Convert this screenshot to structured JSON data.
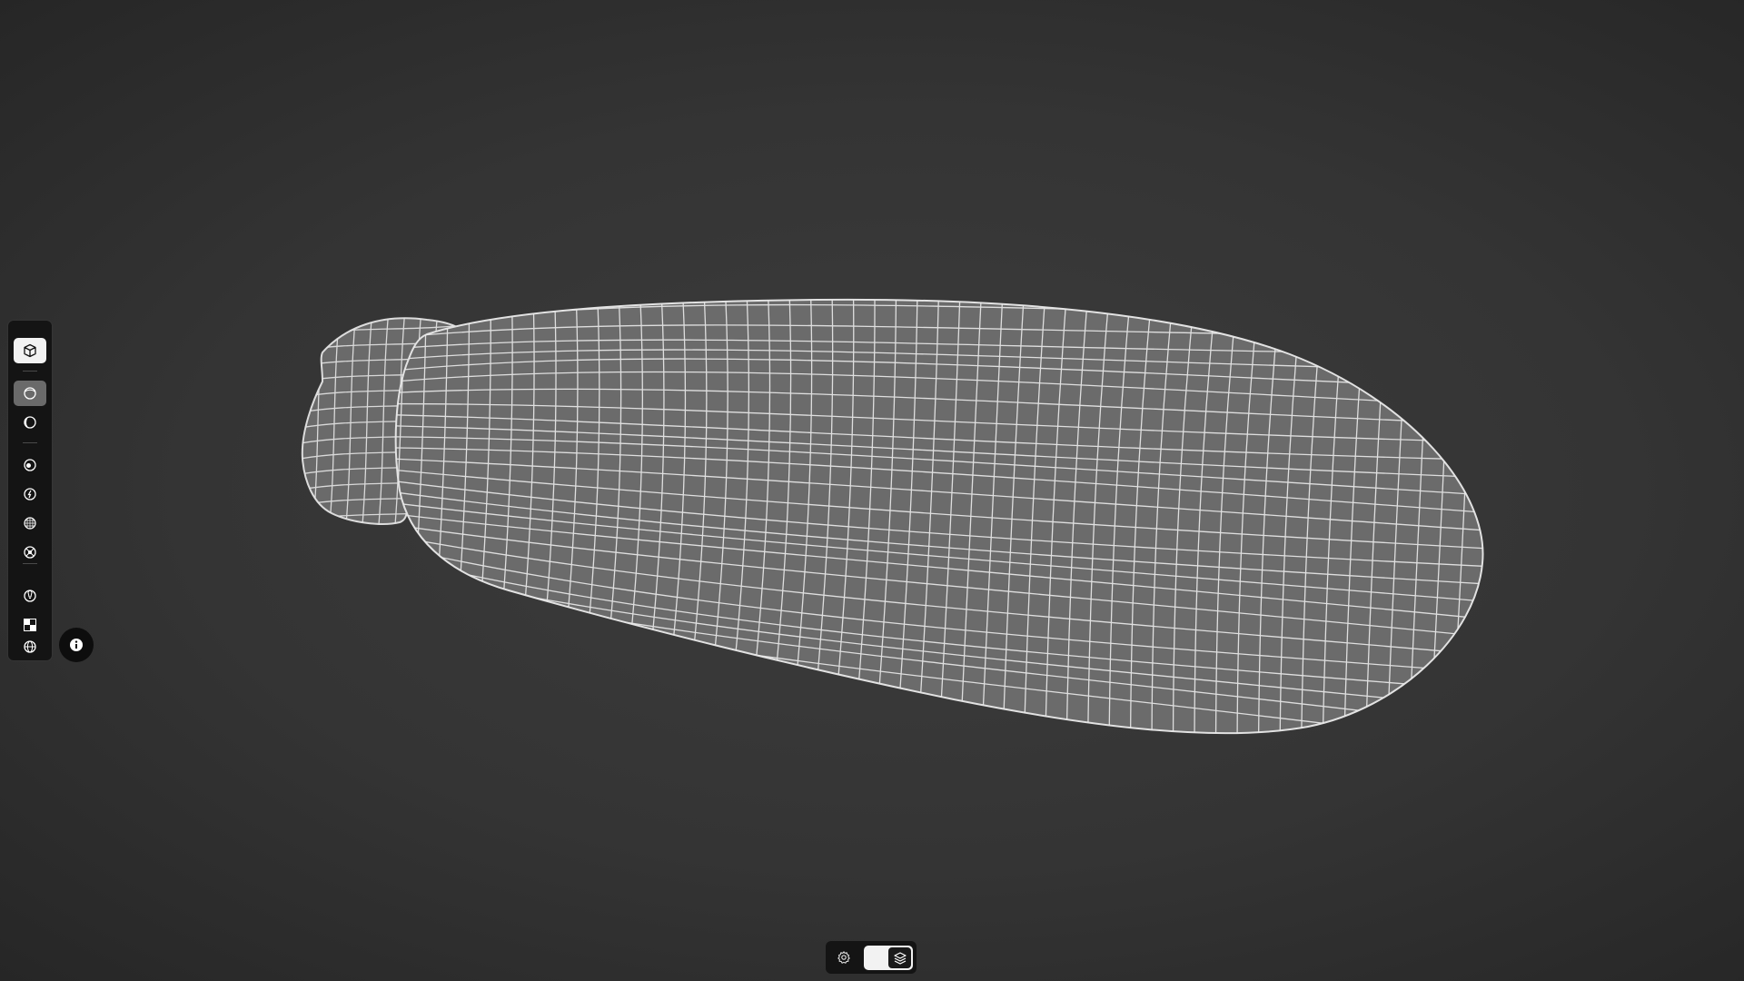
{
  "viewport": {
    "model": "wireframe-mesh",
    "background_color": "#333333",
    "mesh_fill_color": "#6b6b6b",
    "wire_color": "#e8e8e8"
  },
  "toolbar": {
    "items": [
      {
        "icon": "cube-icon",
        "state": "active-white"
      },
      {
        "icon": "solid-sphere-icon",
        "state": "selected"
      },
      {
        "icon": "shaded-sphere-icon",
        "state": "normal"
      },
      {
        "icon": "material-sphere-icon",
        "state": "normal"
      },
      {
        "icon": "lightning-sphere-icon",
        "state": "normal"
      },
      {
        "icon": "wireframe-sphere-icon",
        "state": "normal"
      },
      {
        "icon": "uv-sphere-icon",
        "state": "normal"
      },
      {
        "icon": "lightbulb-icon",
        "state": "normal"
      },
      {
        "icon": "checker-icon",
        "state": "normal"
      },
      {
        "icon": "globe-icon",
        "state": "normal"
      }
    ]
  },
  "info_button": {
    "icon": "info-icon"
  },
  "bottom_bar": {
    "settings_icon": "gear-icon",
    "toggle_icon": "layers-icon",
    "toggle_on": true
  }
}
